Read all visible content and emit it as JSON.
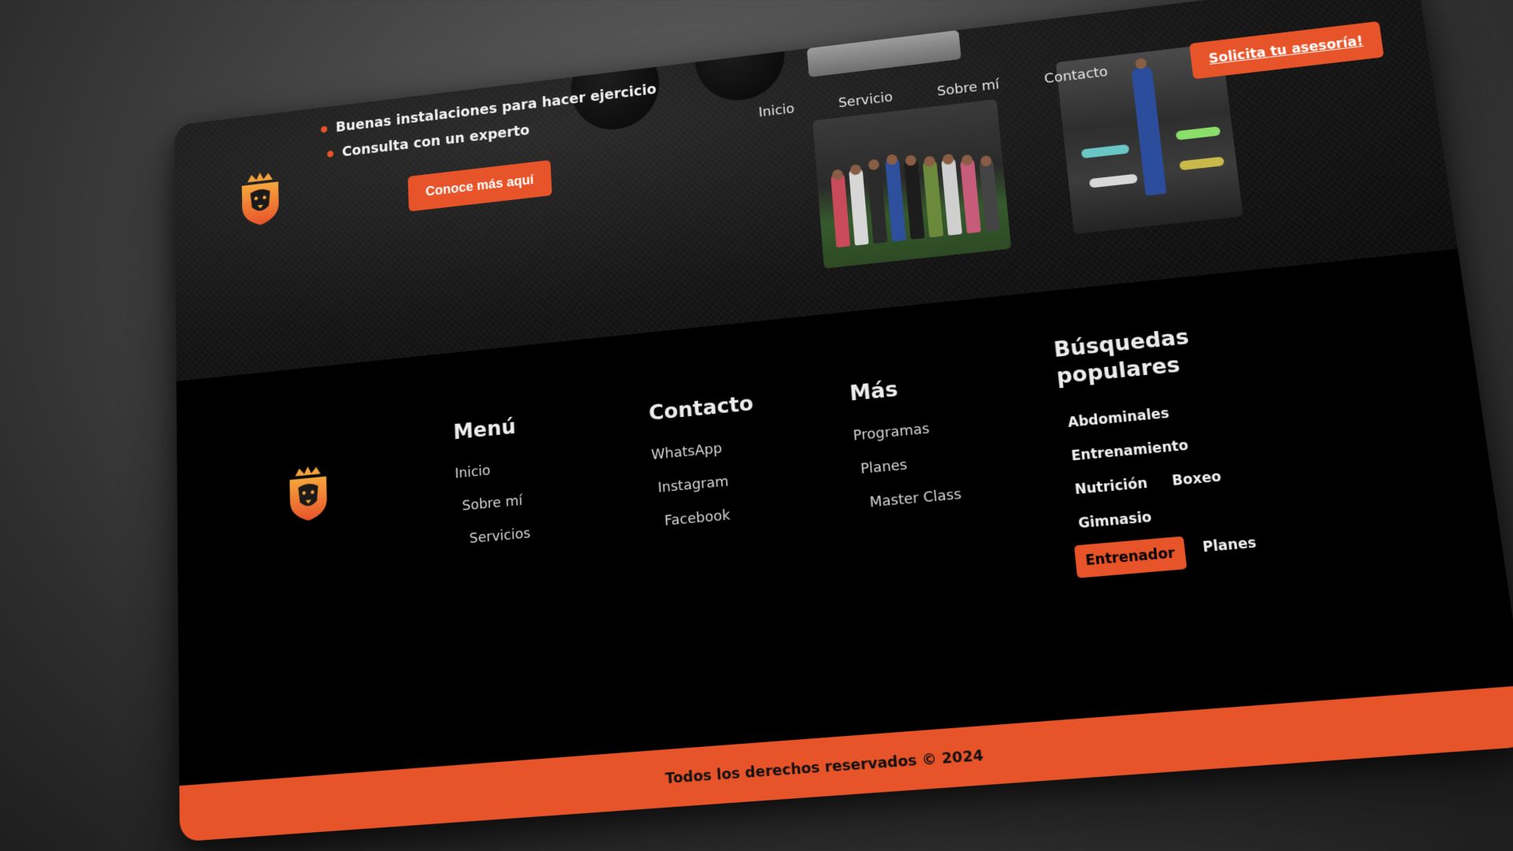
{
  "hero": {
    "bullets": [
      "Buenas instalaciones para hacer ejercicio",
      "Consulta con un experto"
    ],
    "cta_label": "Conoce más aquí"
  },
  "nav": {
    "items": [
      "Inicio",
      "Servicio",
      "Sobre mí",
      "Contacto"
    ],
    "cta_label": "Solicita tu asesoría!"
  },
  "footer": {
    "menu": {
      "title": "Menú",
      "items": [
        "Inicio",
        "Sobre mí",
        "Servicios"
      ]
    },
    "contact": {
      "title": "Contacto",
      "items": [
        "WhatsApp",
        "Instagram",
        "Facebook"
      ]
    },
    "more": {
      "title": "Más",
      "items": [
        "Programas",
        "Planes",
        "Master Class"
      ]
    },
    "popular": {
      "title": "Búsquedas populares",
      "tags": [
        "Abdominales",
        "Entrenamiento",
        "Nutrición",
        "Boxeo",
        "Gimnasio",
        "Entrenador",
        "Planes"
      ],
      "active_tag": "Entrenador"
    },
    "copyright": "Todos los derechos reservados © 2024"
  },
  "colors": {
    "accent": "#e8542a",
    "background": "#000000"
  }
}
